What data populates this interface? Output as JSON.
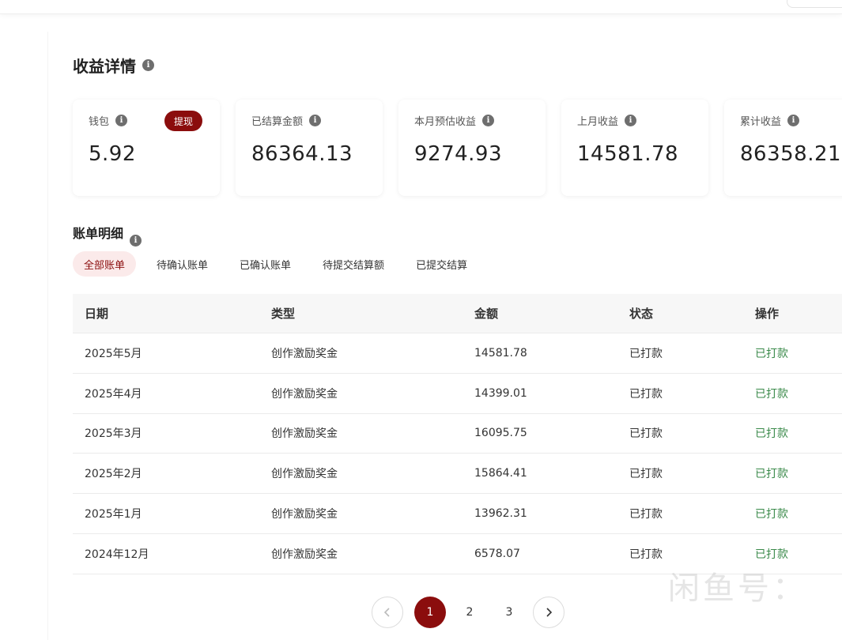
{
  "page": {
    "title": "收益详情"
  },
  "summary_cards": [
    {
      "label": "钱包",
      "value": "5.92",
      "action_label": "提现"
    },
    {
      "label": "已结算金额",
      "value": "86364.13"
    },
    {
      "label": "本月预估收益",
      "value": "9274.93"
    },
    {
      "label": "上月收益",
      "value": "14581.78"
    },
    {
      "label": "累计收益",
      "value": "86358.21"
    }
  ],
  "bills": {
    "title": "账单明细",
    "tabs": [
      {
        "label": "全部账单",
        "active": true
      },
      {
        "label": "待确认账单",
        "active": false
      },
      {
        "label": "已确认账单",
        "active": false
      },
      {
        "label": "待提交结算额",
        "active": false
      },
      {
        "label": "已提交结算",
        "active": false
      }
    ],
    "columns": [
      "日期",
      "类型",
      "金额",
      "状态",
      "操作"
    ],
    "rows": [
      {
        "date": "2025年5月",
        "type": "创作激励奖金",
        "amount": "14581.78",
        "status": "已打款",
        "action": "已打款"
      },
      {
        "date": "2025年4月",
        "type": "创作激励奖金",
        "amount": "14399.01",
        "status": "已打款",
        "action": "已打款"
      },
      {
        "date": "2025年3月",
        "type": "创作激励奖金",
        "amount": "16095.75",
        "status": "已打款",
        "action": "已打款"
      },
      {
        "date": "2025年2月",
        "type": "创作激励奖金",
        "amount": "15864.41",
        "status": "已打款",
        "action": "已打款"
      },
      {
        "date": "2025年1月",
        "type": "创作激励奖金",
        "amount": "13962.31",
        "status": "已打款",
        "action": "已打款"
      },
      {
        "date": "2024年12月",
        "type": "创作激励奖金",
        "amount": "6578.07",
        "status": "已打款",
        "action": "已打款"
      }
    ]
  },
  "pagination": {
    "pages": [
      "1",
      "2",
      "3"
    ],
    "current": "1",
    "prev_icon": "chevron-left-icon",
    "next_icon": "chevron-right-icon"
  },
  "watermark": "闲鱼号：",
  "colors": {
    "brand": "#8b0d0d",
    "action_text": "#3a8a4a",
    "active_tab_bg": "#fbeaea"
  }
}
